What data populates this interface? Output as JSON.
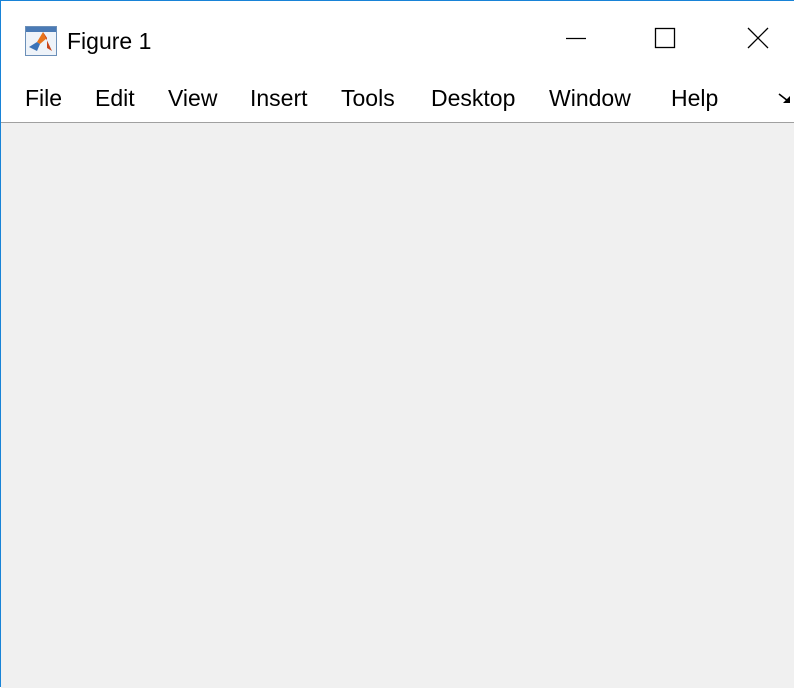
{
  "window": {
    "title": "Figure 1",
    "app_icon": "matlab-icon",
    "controls": {
      "minimize_icon": "minimize-icon",
      "maximize_icon": "maximize-icon",
      "close_icon": "close-icon"
    },
    "border_color": "#1883d7"
  },
  "menubar": {
    "items": [
      {
        "label": "File"
      },
      {
        "label": "Edit"
      },
      {
        "label": "View"
      },
      {
        "label": "Insert"
      },
      {
        "label": "Tools"
      },
      {
        "label": "Desktop"
      },
      {
        "label": "Window"
      },
      {
        "label": "Help"
      }
    ],
    "overflow_icon": "overflow-arrow-icon"
  },
  "figure": {
    "background_color": "#f0f0f0"
  }
}
